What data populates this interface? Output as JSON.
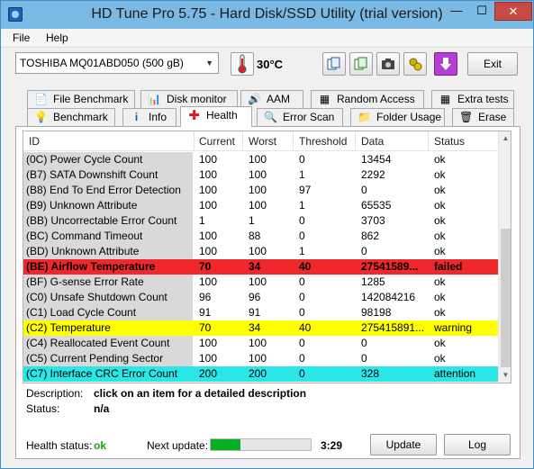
{
  "window": {
    "title": "HD Tune Pro 5.75 - Hard Disk/SSD Utility (trial version)",
    "minimize_glyph": "—",
    "maximize_glyph": "☐",
    "close_glyph": "✕"
  },
  "menu": {
    "file": "File",
    "help": "Help"
  },
  "toolbar": {
    "drive": "TOSHIBA MQ01ABD050 (500 gB)",
    "temperature": "30°C",
    "exit": "Exit",
    "icons": [
      "thermometer-icon",
      "copy-info-icon",
      "copy-screen-icon",
      "screenshot-icon",
      "options-icon",
      "save-icon"
    ]
  },
  "tabs_top": [
    {
      "label": "File Benchmark",
      "icon": "file-benchmark-icon"
    },
    {
      "label": "Disk monitor",
      "icon": "disk-monitor-icon"
    },
    {
      "label": "AAM",
      "icon": "aam-icon"
    },
    {
      "label": "Random Access",
      "icon": "random-access-icon"
    },
    {
      "label": "Extra tests",
      "icon": "extra-tests-icon"
    }
  ],
  "tabs_bottom": [
    {
      "label": "Benchmark",
      "icon": "benchmark-icon"
    },
    {
      "label": "Info",
      "icon": "info-icon"
    },
    {
      "label": "Health",
      "icon": "health-icon",
      "active": true
    },
    {
      "label": "Error Scan",
      "icon": "error-scan-icon"
    },
    {
      "label": "Folder Usage",
      "icon": "folder-icon"
    },
    {
      "label": "Erase",
      "icon": "erase-icon"
    }
  ],
  "grid": {
    "headers": [
      "ID",
      "Current",
      "Worst",
      "Threshold",
      "Data",
      "Status"
    ],
    "rows": [
      {
        "id": "(0C) Power Cycle Count",
        "current": "100",
        "worst": "100",
        "threshold": "0",
        "data": "13454",
        "status": "ok",
        "hl": ""
      },
      {
        "id": "(B7) SATA Downshift Count",
        "current": "100",
        "worst": "100",
        "threshold": "1",
        "data": "2292",
        "status": "ok",
        "hl": ""
      },
      {
        "id": "(B8) End To End Error Detection",
        "current": "100",
        "worst": "100",
        "threshold": "97",
        "data": "0",
        "status": "ok",
        "hl": ""
      },
      {
        "id": "(B9) Unknown Attribute",
        "current": "100",
        "worst": "100",
        "threshold": "1",
        "data": "65535",
        "status": "ok",
        "hl": ""
      },
      {
        "id": "(BB) Uncorrectable Error Count",
        "current": "1",
        "worst": "1",
        "threshold": "0",
        "data": "3703",
        "status": "ok",
        "hl": ""
      },
      {
        "id": "(BC) Command Timeout",
        "current": "100",
        "worst": "88",
        "threshold": "0",
        "data": "862",
        "status": "ok",
        "hl": ""
      },
      {
        "id": "(BD) Unknown Attribute",
        "current": "100",
        "worst": "100",
        "threshold": "1",
        "data": "0",
        "status": "ok",
        "hl": ""
      },
      {
        "id": "(BE) Airflow Temperature",
        "current": "70",
        "worst": "34",
        "threshold": "40",
        "data": "27541589...",
        "status": "failed",
        "hl": "red"
      },
      {
        "id": "(BF) G-sense Error Rate",
        "current": "100",
        "worst": "100",
        "threshold": "0",
        "data": "1285",
        "status": "ok",
        "hl": ""
      },
      {
        "id": "(C0) Unsafe Shutdown Count",
        "current": "96",
        "worst": "96",
        "threshold": "0",
        "data": "142084216",
        "status": "ok",
        "hl": ""
      },
      {
        "id": "(C1) Load Cycle Count",
        "current": "91",
        "worst": "91",
        "threshold": "0",
        "data": "98198",
        "status": "ok",
        "hl": ""
      },
      {
        "id": "(C2) Temperature",
        "current": "70",
        "worst": "34",
        "threshold": "40",
        "data": "275415891...",
        "status": "warning",
        "hl": "yellow"
      },
      {
        "id": "(C4) Reallocated Event Count",
        "current": "100",
        "worst": "100",
        "threshold": "0",
        "data": "0",
        "status": "ok",
        "hl": ""
      },
      {
        "id": "(C5) Current Pending Sector",
        "current": "100",
        "worst": "100",
        "threshold": "0",
        "data": "0",
        "status": "ok",
        "hl": ""
      },
      {
        "id": "(C7) Interface CRC Error Count",
        "current": "200",
        "worst": "200",
        "threshold": "0",
        "data": "328",
        "status": "attention",
        "hl": "cyan"
      }
    ]
  },
  "details": {
    "description_label": "Description:",
    "description_value": "click on an item for a detailed description",
    "status_label": "Status:",
    "status_value": "n/a"
  },
  "footer": {
    "health_label": "Health status:",
    "health_value": "ok",
    "next_update_label": "Next update:",
    "progress_fraction": 0.3,
    "next_update_time": "3:29",
    "update_button": "Update",
    "log_button": "Log"
  },
  "colors": {
    "ok": "#17a117",
    "failed": "#f0282c",
    "warning": "#ffff00",
    "attention": "#2ae6e6",
    "progress": "#06b025"
  }
}
